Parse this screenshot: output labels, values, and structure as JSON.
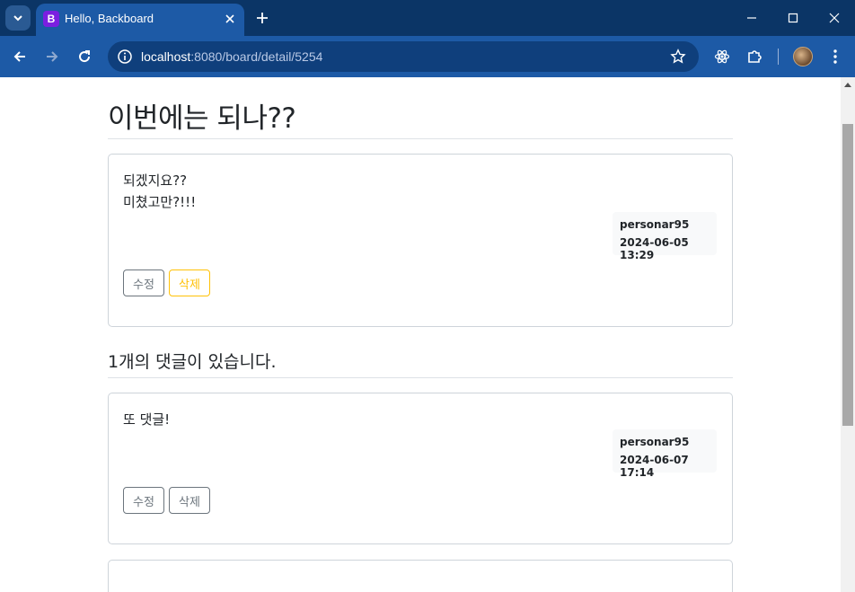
{
  "browser": {
    "tab": {
      "favicon_letter": "B",
      "title": "Hello, Backboard"
    },
    "url": {
      "host": "localhost",
      "rest": ":8080/board/detail/5254"
    }
  },
  "post": {
    "title": "이번에는 되나??",
    "content": "되겠지요??\n미쳤고만?!!!",
    "author": "personar95",
    "date": "2024-06-05 13:29",
    "edit_label": "수정",
    "delete_label": "삭제"
  },
  "comments": {
    "count_text": "1개의 댓글이 있습니다.",
    "items": [
      {
        "content": "또 댓글!",
        "author": "personar95",
        "date": "2024-06-07 17:14",
        "edit_label": "수정",
        "delete_label": "삭제"
      }
    ]
  },
  "colors": {
    "tabbar": "#0b3566",
    "toolbar": "#1d5aa6",
    "warning": "#ffc107",
    "secondary": "#6c757d"
  }
}
